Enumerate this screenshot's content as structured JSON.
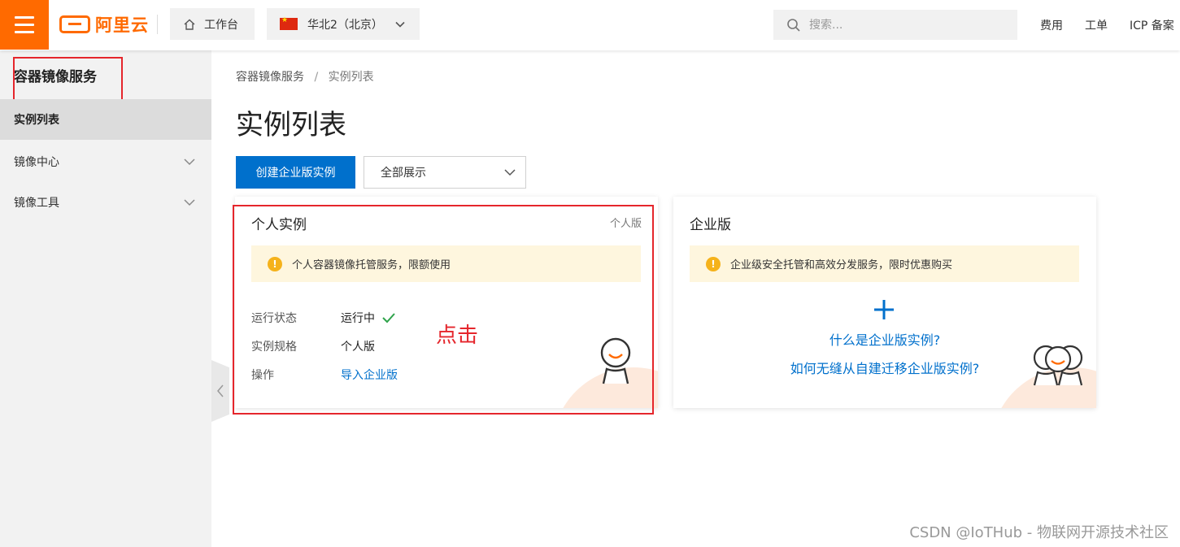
{
  "topbar": {
    "logo_text": "阿里云",
    "workbench_label": "工作台",
    "region_label": "华北2（北京）",
    "search_placeholder": "搜索...",
    "links": [
      "费用",
      "工单",
      "ICP 备案"
    ],
    "accent_color": "#ff6a00"
  },
  "sidebar": {
    "title": "容器镜像服务",
    "items": [
      {
        "label": "实例列表",
        "active": true
      },
      {
        "label": "镜像中心",
        "expandable": true
      },
      {
        "label": "镜像工具",
        "expandable": true
      }
    ]
  },
  "main": {
    "breadcrumb": [
      "容器镜像服务",
      "/",
      "实例列表"
    ],
    "title": "实例列表",
    "create_button": "创建企业版实例",
    "filter_select": "全部展示",
    "primary_color": "#0070cc"
  },
  "personal_card": {
    "title": "个人实例",
    "tag": "个人版",
    "notice": "个人容器镜像托管服务，限额使用",
    "rows": [
      {
        "label": "运行状态",
        "value": "运行中"
      },
      {
        "label": "实例规格",
        "value": "个人版"
      },
      {
        "label": "操作",
        "value": "导入企业版"
      }
    ]
  },
  "enterprise_card": {
    "title": "企业版",
    "notice": "企业级安全托管和高效分发服务，限时优惠购买",
    "link1": "什么是企业版实例?",
    "link2": "如何无缝从自建迁移企业版实例?"
  },
  "annotation": {
    "click_label": "点击",
    "highlight_color": "#e5262c"
  },
  "watermark": "CSDN @IoTHub - 物联网开源技术社区"
}
